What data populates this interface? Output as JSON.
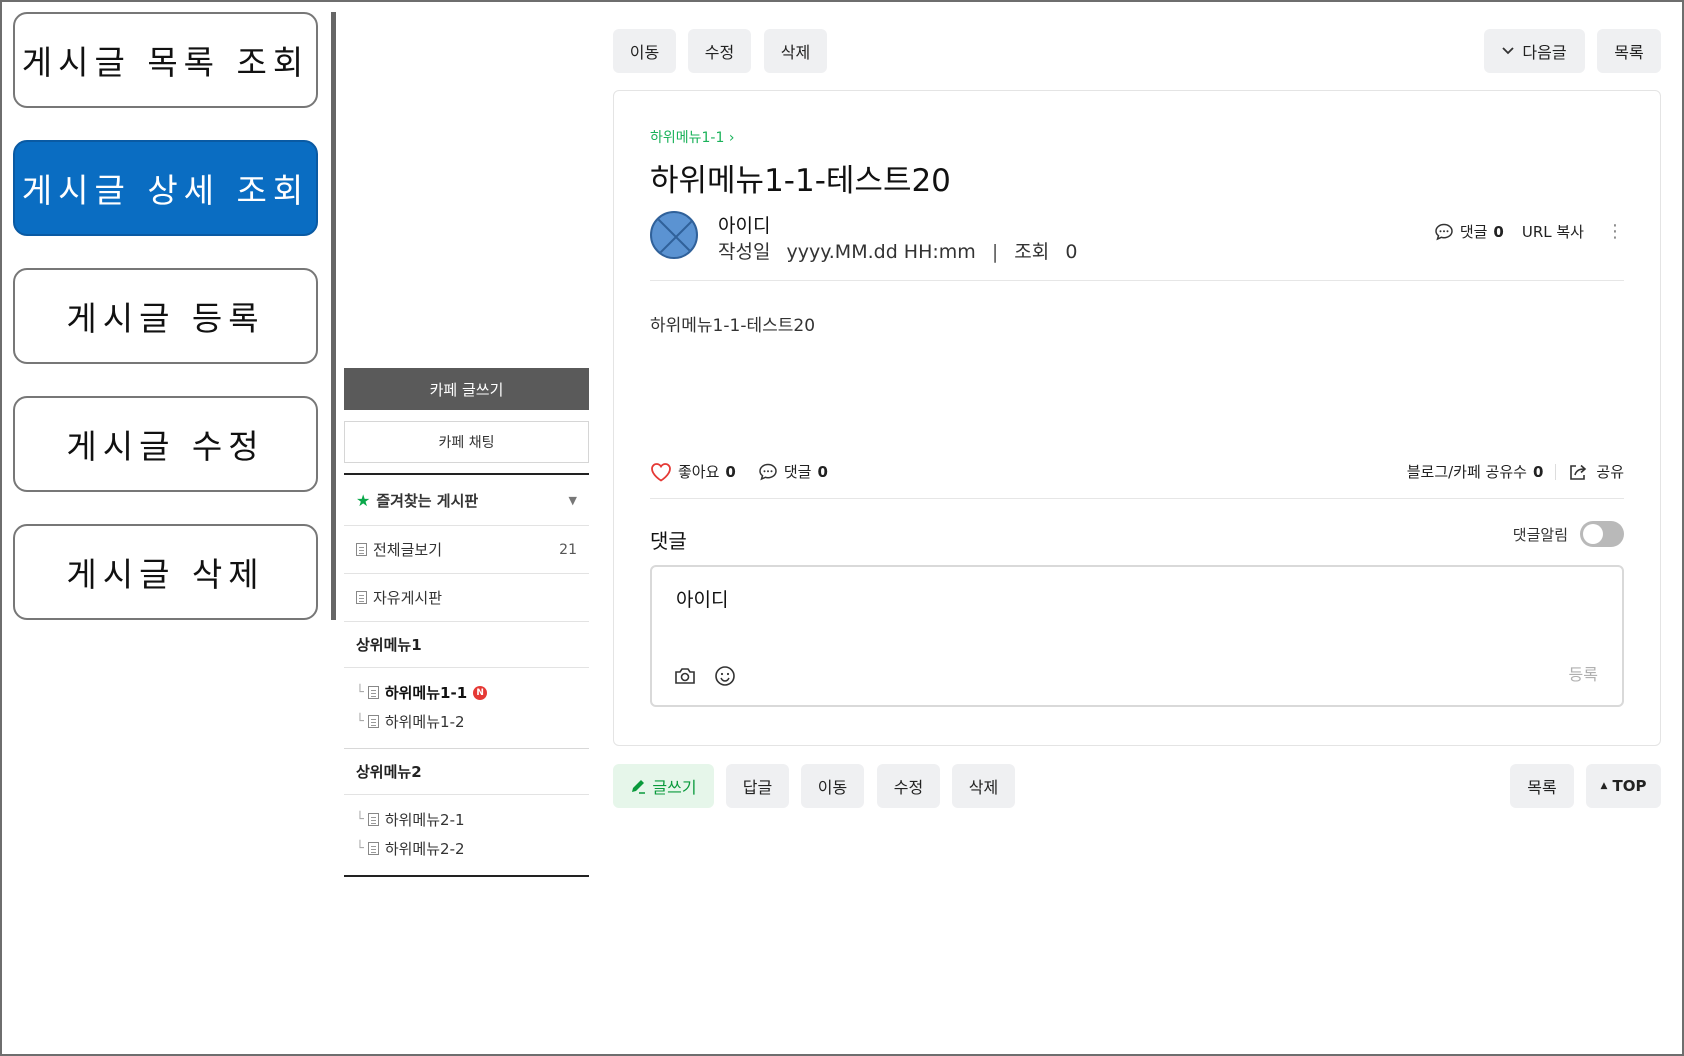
{
  "annotation_nav": {
    "items": [
      {
        "label": "게시글 목록 조회"
      },
      {
        "label": "게시글 상세 조회",
        "active": true
      },
      {
        "label": "게시글 등록"
      },
      {
        "label": "게시글 수정"
      },
      {
        "label": "게시글 삭제"
      }
    ]
  },
  "sidebar": {
    "write_button": "카페 글쓰기",
    "chat_button": "카페 채팅",
    "favorites": "즐겨찾는 게시판",
    "all_posts": {
      "label": "전체글보기",
      "count": "21"
    },
    "free_board": "자유게시판",
    "groups": [
      {
        "title": "상위메뉴1",
        "items": [
          "하위메뉴1-1",
          "하위메뉴1-2"
        ],
        "new_badge": "N"
      },
      {
        "title": "상위메뉴2",
        "items": [
          "하위메뉴2-1",
          "하위메뉴2-2"
        ]
      }
    ]
  },
  "top_toolbar": {
    "move": "이동",
    "edit": "수정",
    "delete": "삭제",
    "next": "다음글",
    "list": "목록"
  },
  "article": {
    "breadcrumb": "하위메뉴1-1",
    "title": "하위메뉴1-1-테스트20",
    "author": "아이디",
    "date_label": "작성일",
    "date_value": "yyyy.MM.dd HH:mm",
    "views_label": "조회",
    "views_value": "0",
    "comments_label": "댓글",
    "comments_count": "0",
    "url_copy": "URL 복사",
    "body": "하위메뉴1-1-테스트20",
    "like_label": "좋아요",
    "like_count": "0",
    "share_count_label": "블로그/카페 공유수",
    "share_count": "0",
    "share": "공유"
  },
  "comments": {
    "title": "댓글",
    "alert_label": "댓글알림",
    "alert_on": false,
    "user": "아이디",
    "submit": "등록"
  },
  "bottom_toolbar": {
    "write": "글쓰기",
    "reply": "답글",
    "move": "이동",
    "edit": "수정",
    "delete": "삭제",
    "list": "목록",
    "top": "TOP"
  },
  "colors": {
    "active_nav": "#0a6dc2",
    "accent_green": "#1ab25a",
    "heart": "#e53935"
  }
}
